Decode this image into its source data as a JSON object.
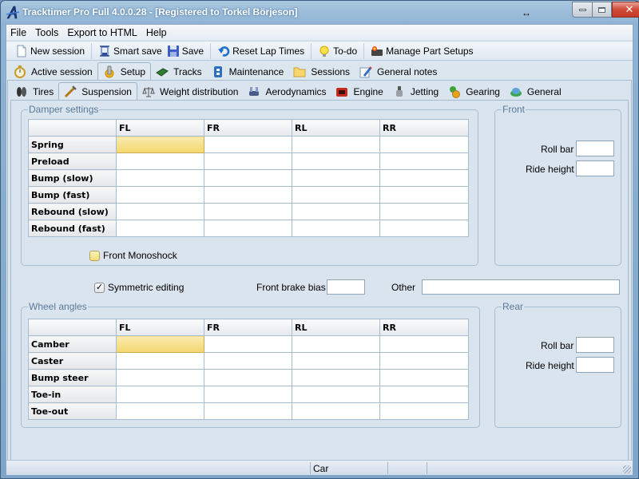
{
  "window": {
    "title": "Tracktimer Pro Full 4.0.0.28  - [Registered to Torkel Börjeson]",
    "resize_indicator": "↔",
    "controls": {
      "minimize": "minimize",
      "maximize": "maximize",
      "close": "✕"
    }
  },
  "menu": [
    "File",
    "Tools",
    "Export to HTML",
    "Help"
  ],
  "toolbar": {
    "new_session": "New session",
    "smart_save": "Smart save",
    "save": "Save",
    "reset_lap_times": "Reset Lap Times",
    "todo": "To-do",
    "manage_part_setups": "Manage Part Setups"
  },
  "main_tabs": [
    {
      "label": "Active session",
      "icon": "stopwatch-icon"
    },
    {
      "label": "Setup",
      "icon": "setup-gear-icon",
      "active": true
    },
    {
      "label": "Tracks",
      "icon": "track-icon"
    },
    {
      "label": "Maintenance",
      "icon": "maintenance-icon"
    },
    {
      "label": "Sessions",
      "icon": "folder-icon"
    },
    {
      "label": "General notes",
      "icon": "notes-pencil-icon"
    }
  ],
  "setup_tabs": [
    {
      "label": "Tires",
      "icon": "tires-icon"
    },
    {
      "label": "Suspension",
      "icon": "suspension-icon",
      "active": true
    },
    {
      "label": "Weight distribution",
      "icon": "scale-icon"
    },
    {
      "label": "Aerodynamics",
      "icon": "aerodynamics-icon"
    },
    {
      "label": "Engine",
      "icon": "engine-icon"
    },
    {
      "label": "Jetting",
      "icon": "jetting-icon"
    },
    {
      "label": "Gearing",
      "icon": "gearing-icon"
    },
    {
      "label": "General",
      "icon": "general-icon"
    }
  ],
  "damper": {
    "title": "Damper settings",
    "columns": [
      "",
      "FL",
      "FR",
      "RL",
      "RR"
    ],
    "rows": [
      "Spring",
      "Preload",
      "Bump (slow)",
      "Bump (fast)",
      "Rebound (slow)",
      "Rebound (fast)"
    ],
    "values": [
      [
        "",
        "",
        "",
        ""
      ],
      [
        "",
        "",
        "",
        ""
      ],
      [
        "",
        "",
        "",
        ""
      ],
      [
        "",
        "",
        "",
        ""
      ],
      [
        "",
        "",
        "",
        ""
      ],
      [
        "",
        "",
        "",
        ""
      ]
    ],
    "front_monoshock": "Front Monoshock",
    "front_monoshock_checked": false
  },
  "front": {
    "title": "Front",
    "roll_bar_label": "Roll bar",
    "roll_bar": "",
    "ride_height_label": "Ride height",
    "ride_height": ""
  },
  "symmetric_editing": {
    "label": "Symmetric editing",
    "checked": true
  },
  "front_brake_bias": {
    "label": "Front brake bias",
    "value": ""
  },
  "other": {
    "label": "Other",
    "value": ""
  },
  "wheel_angles": {
    "title": "Wheel angles",
    "columns": [
      "",
      "FL",
      "FR",
      "RL",
      "RR"
    ],
    "rows": [
      "Camber",
      "Caster",
      "Bump steer",
      "Toe-in",
      "Toe-out"
    ],
    "values": [
      [
        "",
        "",
        "",
        ""
      ],
      [
        "",
        "",
        "",
        ""
      ],
      [
        "",
        "",
        "",
        ""
      ],
      [
        "",
        "",
        "",
        ""
      ],
      [
        "",
        "",
        "",
        ""
      ]
    ]
  },
  "rear": {
    "title": "Rear",
    "roll_bar_label": "Roll bar",
    "roll_bar": "",
    "ride_height_label": "Ride height",
    "ride_height": ""
  },
  "status": {
    "panel2": "Car"
  }
}
